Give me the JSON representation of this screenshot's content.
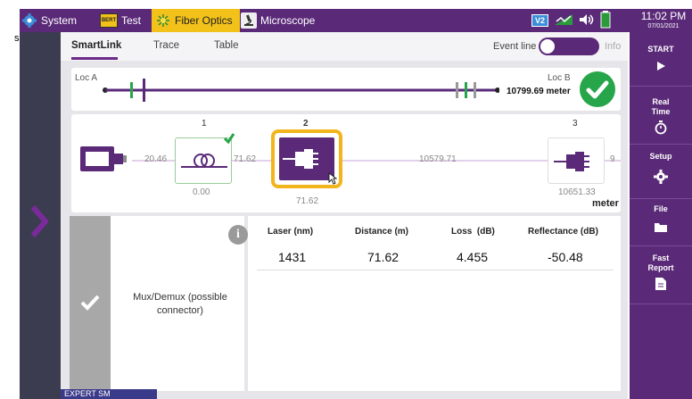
{
  "topbar": {
    "system_label": "System",
    "test_label": "Test",
    "test_icon_text": "BERT",
    "fiber_label": "Fiber Optics",
    "microscope_label": "Microscope",
    "time": "11:02 PM",
    "date": "07/01/2021",
    "badge": "V2"
  },
  "stray_char": "s",
  "tabs": [
    "SmartLink",
    "Trace",
    "Table"
  ],
  "event_line": {
    "label": "Event line",
    "info_label": "Info",
    "on": false
  },
  "overview": {
    "loc_a": "Loc A",
    "loc_b": "Loc B",
    "loc_b_value": "10799.69 meter",
    "status": "pass"
  },
  "schematic": {
    "seg1": "20.46",
    "seg2": "71.62",
    "seg3": "10579.71",
    "seg4": "9",
    "events": [
      {
        "num": "1",
        "pos": "0.00",
        "type": "splice"
      },
      {
        "num": "2",
        "pos": "71.62",
        "type": "connector"
      },
      {
        "num": "3",
        "pos": "10651.33",
        "type": "connector"
      }
    ],
    "unit": "meter"
  },
  "detail": {
    "description": "Mux/Demux (possible connector)",
    "headers": [
      "Laser (nm)",
      "Distance (m)",
      "Loss  (dB)",
      "Reflectance (dB)"
    ],
    "values": [
      "1431",
      "71.62",
      "4.455",
      "-50.48"
    ]
  },
  "footer_label": "EXPERT SM",
  "right_panel": [
    {
      "label": "START",
      "icon": "play-icon"
    },
    {
      "label": "Real Time",
      "icon": "stopwatch-icon"
    },
    {
      "label": "Setup",
      "icon": "gear-icon"
    },
    {
      "label": "File",
      "icon": "folder-icon"
    },
    {
      "label": "Fast Report",
      "icon": "report-icon"
    }
  ],
  "colors": {
    "accent": "#5a2a78",
    "highlight": "#f2b51c",
    "pass": "#27a54a",
    "marker_green": "#27a54a"
  }
}
